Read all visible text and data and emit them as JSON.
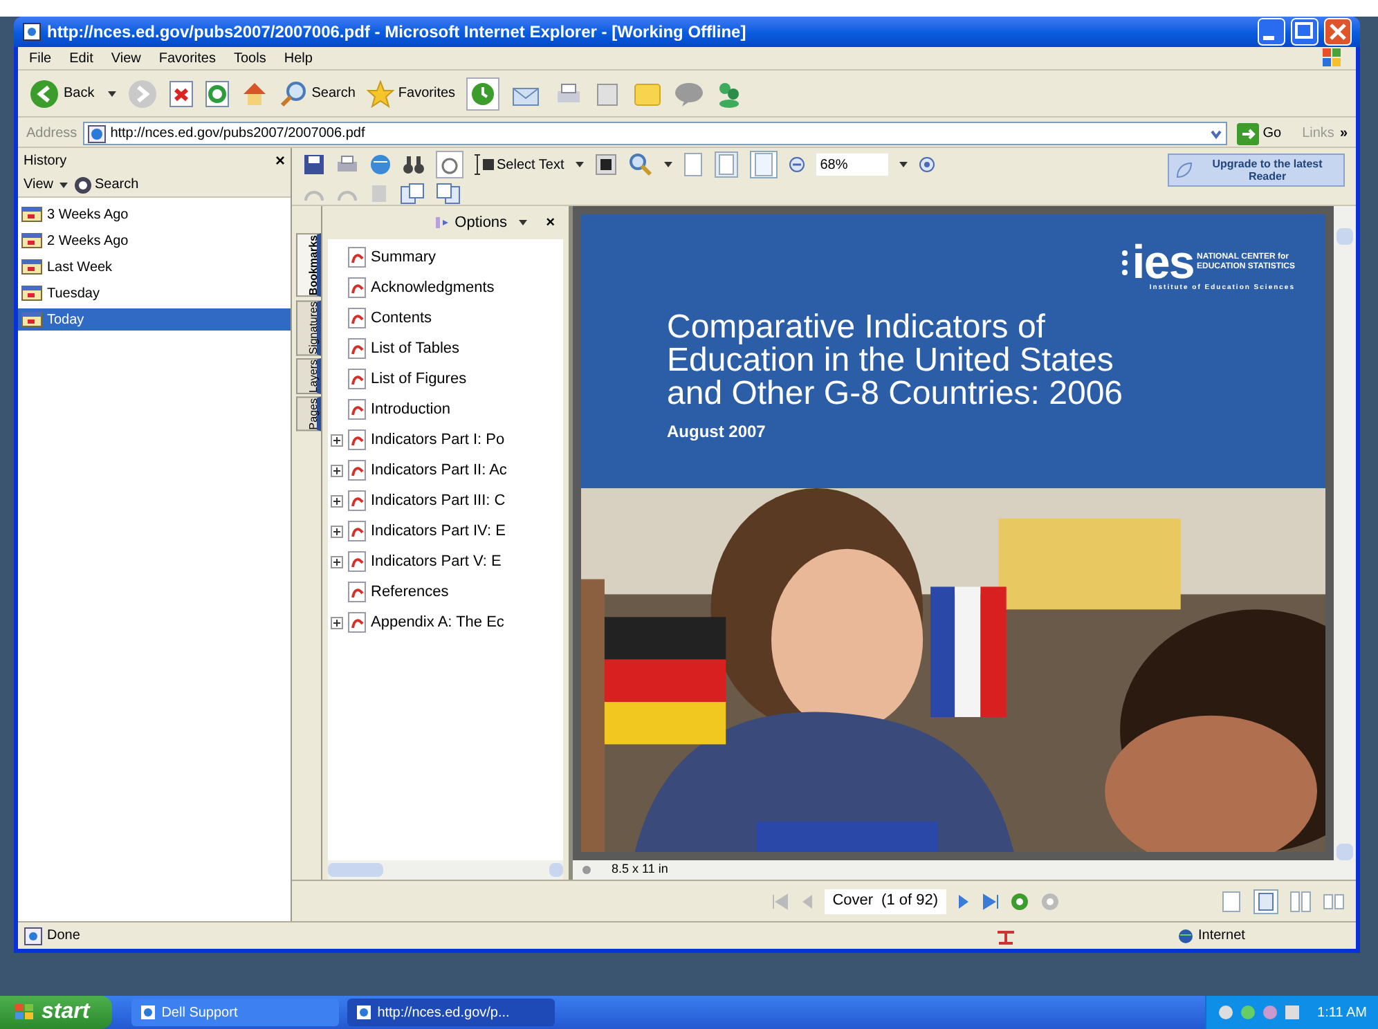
{
  "window": {
    "title": "http://nces.ed.gov/pubs2007/2007006.pdf - Microsoft Internet Explorer - [Working Offline]"
  },
  "menu": [
    "File",
    "Edit",
    "View",
    "Favorites",
    "Tools",
    "Help"
  ],
  "toolbar": {
    "back": "Back",
    "search": "Search",
    "favorites": "Favorites"
  },
  "address_bar": {
    "label": "Address",
    "value": "http://nces.ed.gov/pubs2007/2007006.pdf",
    "go": "Go",
    "links": "Links",
    "more": "»"
  },
  "history": {
    "title": "History",
    "close": "×",
    "view": "View",
    "search": "Search",
    "items": [
      {
        "label": "3 Weeks Ago",
        "selected": false
      },
      {
        "label": "2 Weeks Ago",
        "selected": false
      },
      {
        "label": "Last Week",
        "selected": false
      },
      {
        "label": "Tuesday",
        "selected": false
      },
      {
        "label": "Today",
        "selected": true
      }
    ]
  },
  "reader_toolbar": {
    "select_text": "Select Text",
    "zoom": "68%",
    "upgrade": "Upgrade to the latest Reader"
  },
  "nav_tabs": [
    {
      "label": "Bookmarks",
      "selected": true
    },
    {
      "label": "Signatures",
      "selected": false
    },
    {
      "label": "Layers",
      "selected": false
    },
    {
      "label": "Pages",
      "selected": false
    }
  ],
  "bookmarks": {
    "options": "Options",
    "close": "×",
    "items": [
      {
        "label": "Summary",
        "expandable": false
      },
      {
        "label": "Acknowledgments",
        "expandable": false
      },
      {
        "label": "Contents",
        "expandable": false
      },
      {
        "label": "List of Tables",
        "expandable": false
      },
      {
        "label": "List of Figures",
        "expandable": false
      },
      {
        "label": "Introduction",
        "expandable": false
      },
      {
        "label": "Indicators Part I: Po",
        "expandable": true
      },
      {
        "label": "Indicators Part II: Ac",
        "expandable": true
      },
      {
        "label": "Indicators Part III: C",
        "expandable": true
      },
      {
        "label": "Indicators Part IV: E",
        "expandable": true
      },
      {
        "label": "Indicators Part V: E",
        "expandable": true
      },
      {
        "label": "References",
        "expandable": false
      },
      {
        "label": "Appendix A: The Ec",
        "expandable": true
      }
    ]
  },
  "cover": {
    "logo": "ies",
    "logo_line_1": "NATIONAL CENTER for",
    "logo_line_2": "EDUCATION STATISTICS",
    "logo_sub": "Institute of Education Sciences",
    "title_lines": [
      "Comparative Indicators of",
      "Education in the United States",
      "and Other G-8 Countries: 2006"
    ],
    "date": "August 2007",
    "photo": {
      "kind": "picture"
    }
  },
  "page_size": "8.5 x 11 in",
  "page_nav": {
    "page": "Cover",
    "count": "(1 of 92)"
  },
  "status_bar": {
    "text": "Done",
    "zone": "Internet"
  },
  "taskbar": {
    "start": "start",
    "tasks": [
      {
        "label": "Dell Support",
        "selected": false
      },
      {
        "label": "http://nces.ed.gov/p...",
        "selected": true
      }
    ],
    "clock": "1:11 AM"
  }
}
